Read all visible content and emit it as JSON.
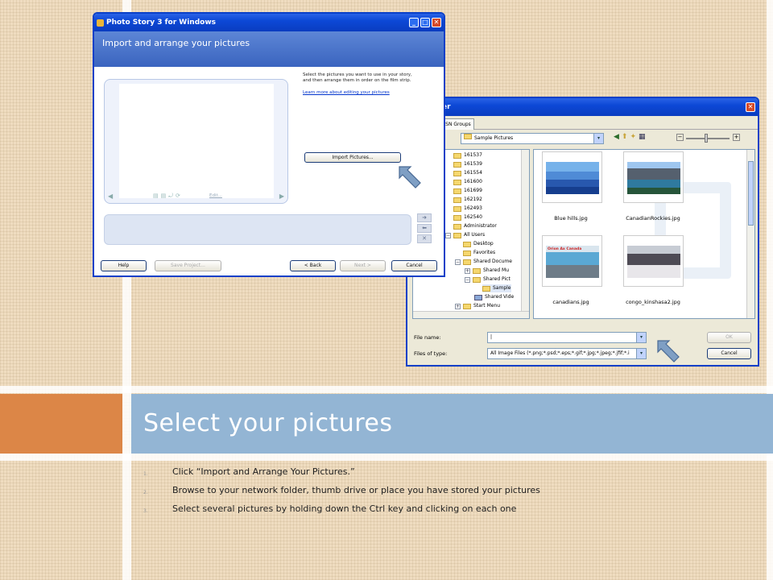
{
  "slide": {
    "title": "Select your pictures",
    "steps": [
      {
        "num": "1.",
        "text": "Click “Import and Arrange Your Pictures.”"
      },
      {
        "num": "2.",
        "text": "Browse to your network folder, thumb drive or place you have stored your pictures"
      },
      {
        "num": "3.",
        "text": "Select  several pictures by holding down the Ctrl key and clicking on each one"
      }
    ],
    "colors": {
      "accent_orange": "#dc8647",
      "title_bar_blue": "#93b5d4",
      "background": "#efdcc0"
    }
  },
  "photo_story": {
    "window_title": "Photo Story 3 for Windows",
    "header": "Import and arrange your pictures",
    "description_1": "Select the pictures you want to use in your story,",
    "description_2": "and then arrange them in order on the film strip.",
    "learn_more": "Learn more about editing your pictures",
    "import_button": "Import Pictures...",
    "edit_label": "Edit...",
    "buttons": {
      "help": "Help",
      "save_project": "Save Project...",
      "back": "< Back",
      "next": "Next >",
      "cancel": "Cancel"
    }
  },
  "file_dialog": {
    "title_fragment": "er",
    "tab": "MSN Groups",
    "look_in": "Sample Pictures",
    "tree": [
      {
        "label": "161537"
      },
      {
        "label": "161539"
      },
      {
        "label": "161554"
      },
      {
        "label": "161600"
      },
      {
        "label": "161699"
      },
      {
        "label": "162192"
      },
      {
        "label": "162493"
      },
      {
        "label": "162540"
      },
      {
        "label": "Administrator"
      },
      {
        "label": "All Users"
      },
      {
        "label": "Desktop"
      },
      {
        "label": "Favorites"
      },
      {
        "label": "Shared Docume"
      },
      {
        "label": "Shared Mu"
      },
      {
        "label": "Shared Pict"
      },
      {
        "label": "Sample"
      },
      {
        "label": "Shared Vide"
      },
      {
        "label": "Start Menu"
      }
    ],
    "thumbnails": [
      {
        "name": "Blue hills.jpg"
      },
      {
        "name": "CanadianRockies.jpg"
      },
      {
        "name": "canadians.jpg",
        "overlay": "Orion Ax Canada"
      },
      {
        "name": "congo_kinshasa2.jpg"
      }
    ],
    "file_name_label": "File name:",
    "file_name_value": "|",
    "files_of_type_label": "Files of type:",
    "files_of_type_value": "All Image Files (*.png;*.psd;*.eps;*.gif;*.jpg;*.jpeg;*.jfif;*.i",
    "ok": "OK",
    "cancel": "Cancel"
  }
}
